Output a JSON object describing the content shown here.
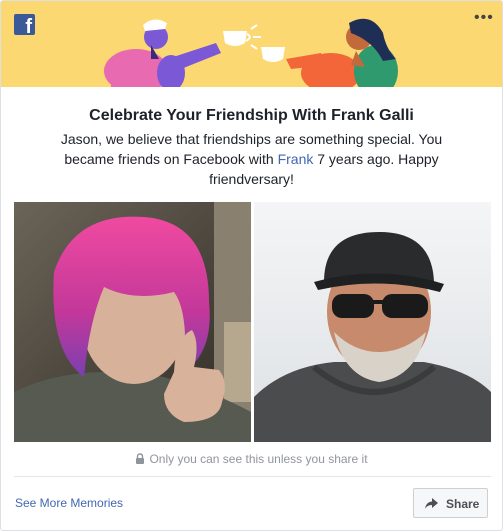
{
  "banner": {
    "logo_glyph": "f",
    "more_glyph": "•••"
  },
  "header": {
    "title": "Celebrate Your Friendship With Frank Galli"
  },
  "message": {
    "before_link": "Jason, we believe that friendships are something special. You became friends on Facebook with ",
    "link_text": "Frank",
    "after_link": " 7 years ago. Happy friendversary!"
  },
  "photos": [
    {
      "icon": "photo-pink-hair-thumbs-up"
    },
    {
      "icon": "photo-man-cap-sunglasses"
    }
  ],
  "privacy": {
    "icon": "lock-icon",
    "text": "Only you can see this unless you share it"
  },
  "footer": {
    "see_more_label": "See More Memories",
    "share_label": "Share"
  },
  "colors": {
    "banner": "#fcd872",
    "link": "#4267b2",
    "facebook_blue": "#3b5998"
  }
}
